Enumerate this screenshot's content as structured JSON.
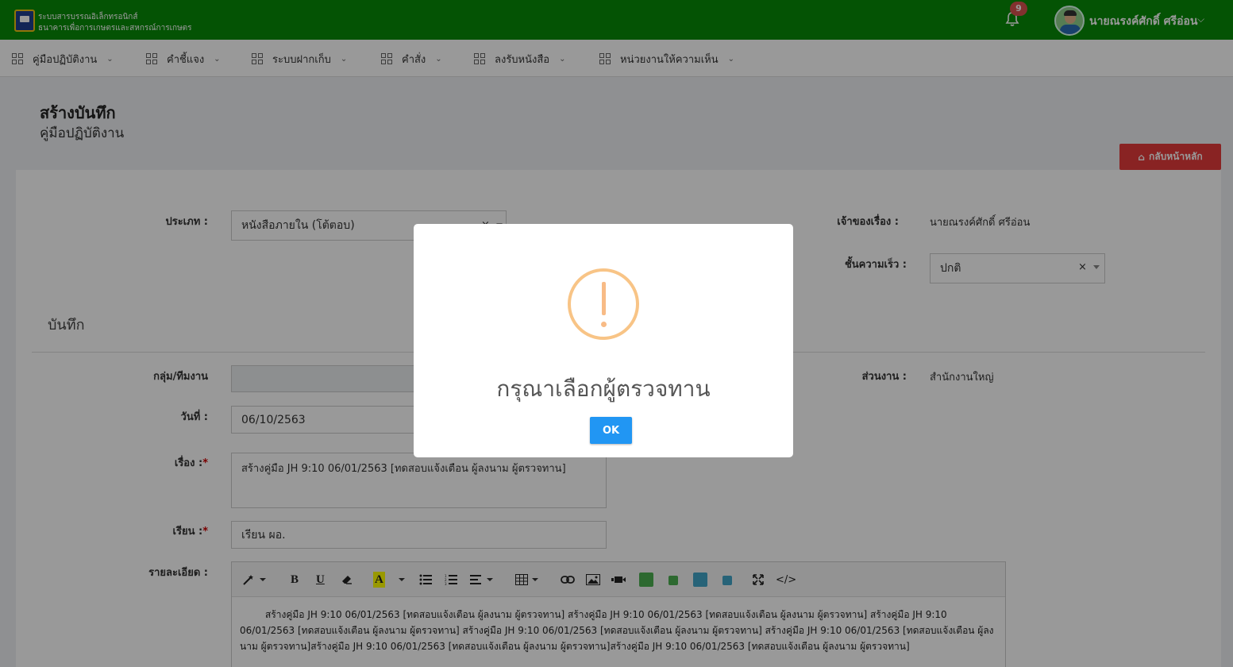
{
  "topbar": {
    "brand_line1": "ระบบสารบรรณอิเล็กทรอนิกส์",
    "brand_line2": "ธนาคารเพื่อการเกษตรและสหกรณ์การเกษตร",
    "notification_count": "9",
    "user_name": "นายณรงค์ศักดิ์ ศรีอ่อน",
    "colors": {
      "bar": "#078a07",
      "badge": "#d9534f"
    }
  },
  "menu": {
    "items": [
      {
        "label": "คู่มือปฏิบัติงาน"
      },
      {
        "label": "คำชี้แจง"
      },
      {
        "label": "ระบบฝากเก็บ"
      },
      {
        "label": "คำสั่ง"
      },
      {
        "label": "ลงรับหนังสือ"
      },
      {
        "label": "หน่วยงานให้ความเห็น"
      }
    ]
  },
  "page": {
    "title": "สร้างบันทึก",
    "subtitle": "คู่มือปฏิบัติงาน",
    "home_button": "กลับหน้าหลัก",
    "home_button_color": "#e53b3b"
  },
  "form": {
    "type_label": "ประเภท :",
    "type_value": "หนังสือภายใน (โต้ตอบ)",
    "owner_label": "เจ้าของเรื่อง :",
    "owner_value": "นายณรงค์ศักดิ์ ศรีอ่อน",
    "speed_label": "ชั้นความเร็ว :",
    "speed_value": "ปกติ",
    "section_title": "บันทึก",
    "group_label": "กลุ่ม/ทีมงาน",
    "dept_label": "ส่วนงาน :",
    "dept_value": "สำนักงานใหญ่",
    "date_label": "วันที่ :",
    "date_value": "06/10/2563",
    "subject_label": "เรื่อง :",
    "subject_value": "สร้างคู่มือ JH 9:10 06/01/2563 [ทดสอบแจ้งเตือน ผู้ลงนาม ผู้ตรวจทาน]",
    "to_label": "เรียน :",
    "to_value": "เรียน ผอ.",
    "detail_label": "รายละเอียด :",
    "required_mark": "*",
    "detail_text": "สร้างคู่มือ JH 9:10 06/01/2563 [ทดสอบแจ้งเตือน ผู้ลงนาม ผู้ตรวจทาน] สร้างคู่มือ JH 9:10 06/01/2563 [ทดสอบแจ้งเตือน ผู้ลงนาม ผู้ตรวจทาน] สร้างคู่มือ JH 9:10 06/01/2563 [ทดสอบแจ้งเตือน ผู้ลงนาม ผู้ตรวจทาน] สร้างคู่มือ JH 9:10 06/01/2563 [ทดสอบแจ้งเตือน ผู้ลงนาม ผู้ตรวจทาน]  สร้างคู่มือ JH 9:10 06/01/2563 [ทดสอบแจ้งเตือน ผู้ลงนาม ผู้ตรวจทาน]สร้างคู่มือ JH 9:10 06/01/2563 [ทดสอบแจ้งเตือน ผู้ลงนาม ผู้ตรวจทาน]สร้างคู่มือ JH 9:10 06/01/2563 [ทดสอบแจ้งเตือน ผู้ลงนาม ผู้ตรวจทาน]",
    "clear_symbol": "×"
  },
  "editor_toolbar": {
    "bold": "B",
    "underline": "U",
    "highlight": "A",
    "code": "</>",
    "swatch_colors": [
      "#4caf50",
      "#4caf50",
      "#42a5c9",
      "#42a5c9"
    ],
    "icons": [
      "magic-icon",
      "eraser-icon",
      "list-ul-icon",
      "list-ol-icon",
      "align-icon",
      "table-icon",
      "link-icon",
      "picture-icon",
      "video-icon",
      "fullscreen-icon"
    ]
  },
  "modal": {
    "message": "กรุณาเลือกผู้ตรวจทาน",
    "ok_label": "OK",
    "icon": "warning-icon",
    "ok_color": "#2196f3"
  }
}
